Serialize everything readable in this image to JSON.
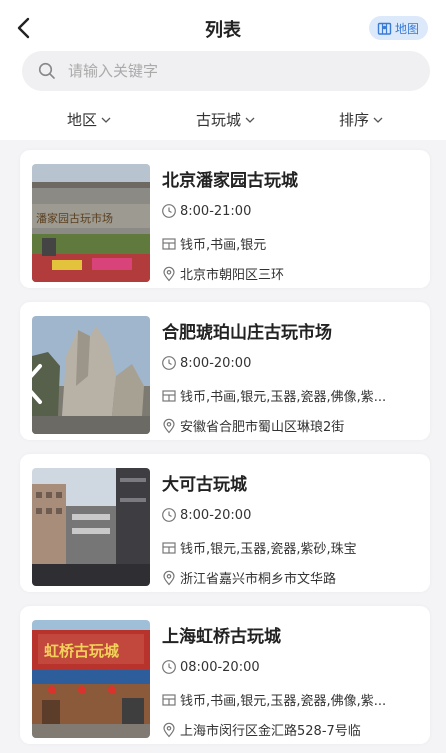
{
  "header": {
    "title": "列表",
    "map_label": "地图"
  },
  "search": {
    "placeholder": "请输入关键字"
  },
  "filters": [
    {
      "label": "地区"
    },
    {
      "label": "古玩城"
    },
    {
      "label": "排序"
    }
  ],
  "markets": [
    {
      "name": "北京潘家园古玩城",
      "hours": "8:00-21:00",
      "items": "钱币,书画,银元",
      "address": "北京市朝阳区三环",
      "thumb_sign": "潘家园古玩市场"
    },
    {
      "name": "合肥琥珀山庄古玩市场",
      "hours": "8:00-20:00",
      "items": "钱币,书画,银元,玉器,瓷器,佛像,紫...",
      "address": "安徽省合肥市蜀山区琳琅2街"
    },
    {
      "name": "大可古玩城",
      "hours": "8:00-20:00",
      "items": "钱币,银元,玉器,瓷器,紫砂,珠宝",
      "address": "浙江省嘉兴市桐乡市文华路"
    },
    {
      "name": "上海虹桥古玩城",
      "hours": "08:00-20:00",
      "items": "钱币,书画,银元,玉器,瓷器,佛像,紫...",
      "address": "上海市闵行区金汇路528-7号临",
      "thumb_sign": "虹桥古玩城"
    }
  ],
  "colors": {
    "accent": "#3a7bd5",
    "map_bg": "#dbe9fb",
    "page_bg": "#f4f4f6"
  },
  "icons": {
    "back": "chevron-left-icon",
    "map": "map-icon",
    "search": "search-icon",
    "hours": "clock-icon",
    "items": "category-icon",
    "address": "location-pin-icon",
    "side": "chevron-left-icon"
  }
}
